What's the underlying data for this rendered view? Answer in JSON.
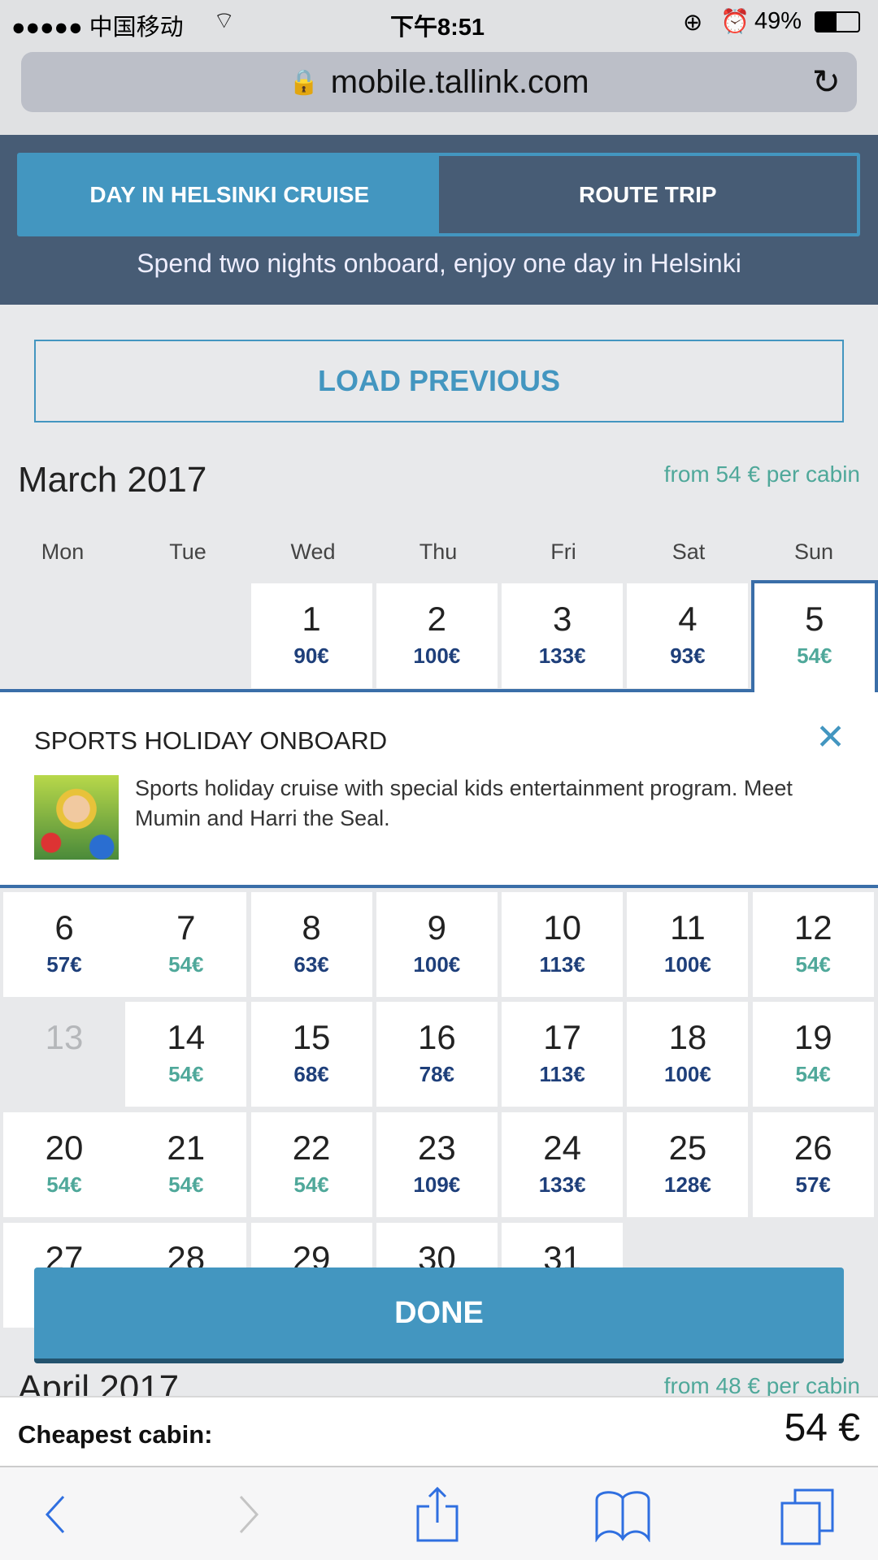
{
  "status_bar": {
    "carrier": "●●●●● 中国移动",
    "time": "下午8:51",
    "battery": "49%",
    "battery_level": 0.49
  },
  "browser": {
    "url": "mobile.tallink.com"
  },
  "header": {
    "tabs": [
      {
        "label": "DAY IN HELSINKI CRUISE",
        "active": true
      },
      {
        "label": "ROUTE TRIP",
        "active": false
      }
    ],
    "subtitle": "Spend two nights onboard, enjoy one day in Helsinki"
  },
  "load_previous": "LOAD PREVIOUS",
  "weekdays": [
    "Mon",
    "Tue",
    "Wed",
    "Thu",
    "Fri",
    "Sat",
    "Sun"
  ],
  "march": {
    "title": "March 2017",
    "from": "from 54 € per cabin",
    "selected_day": "5",
    "days": [
      {
        "d": "1",
        "p": "90€"
      },
      {
        "d": "2",
        "p": "100€"
      },
      {
        "d": "3",
        "p": "133€"
      },
      {
        "d": "4",
        "p": "93€"
      },
      {
        "d": "5",
        "p": "54€",
        "cheap": true
      },
      {
        "d": "6",
        "p": "57€"
      },
      {
        "d": "7",
        "p": "54€",
        "cheap": true
      },
      {
        "d": "8",
        "p": "63€"
      },
      {
        "d": "9",
        "p": "100€"
      },
      {
        "d": "10",
        "p": "113€"
      },
      {
        "d": "11",
        "p": "100€"
      },
      {
        "d": "12",
        "p": "54€",
        "cheap": true
      },
      {
        "d": "13",
        "p": "",
        "disabled": true
      },
      {
        "d": "14",
        "p": "54€",
        "cheap": true
      },
      {
        "d": "15",
        "p": "68€"
      },
      {
        "d": "16",
        "p": "78€"
      },
      {
        "d": "17",
        "p": "113€"
      },
      {
        "d": "18",
        "p": "100€"
      },
      {
        "d": "19",
        "p": "54€",
        "cheap": true
      },
      {
        "d": "20",
        "p": "54€",
        "cheap": true
      },
      {
        "d": "21",
        "p": "54€",
        "cheap": true
      },
      {
        "d": "22",
        "p": "54€",
        "cheap": true
      },
      {
        "d": "23",
        "p": "109€"
      },
      {
        "d": "24",
        "p": "133€"
      },
      {
        "d": "25",
        "p": "128€"
      },
      {
        "d": "26",
        "p": "57€"
      },
      {
        "d": "27",
        "p": ""
      },
      {
        "d": "28",
        "p": ""
      },
      {
        "d": "29",
        "p": ""
      },
      {
        "d": "30",
        "p": ""
      },
      {
        "d": "31",
        "p": ""
      }
    ]
  },
  "popup": {
    "title": "SPORTS HOLIDAY ONBOARD",
    "text": "Sports holiday cruise with special kids entertainment program. Meet Mumin and Harri the Seal."
  },
  "done": "DONE",
  "april": {
    "title": "April 2017",
    "from": "from 48 € per cabin"
  },
  "cheapest": {
    "label": "Cheapest cabin:",
    "value": "54 €"
  },
  "colors": {
    "accent": "#4396c0",
    "header": "#475c75",
    "cheap": "#4fa89a",
    "price": "#1e3f7a",
    "selected": "#3a6ea8"
  }
}
